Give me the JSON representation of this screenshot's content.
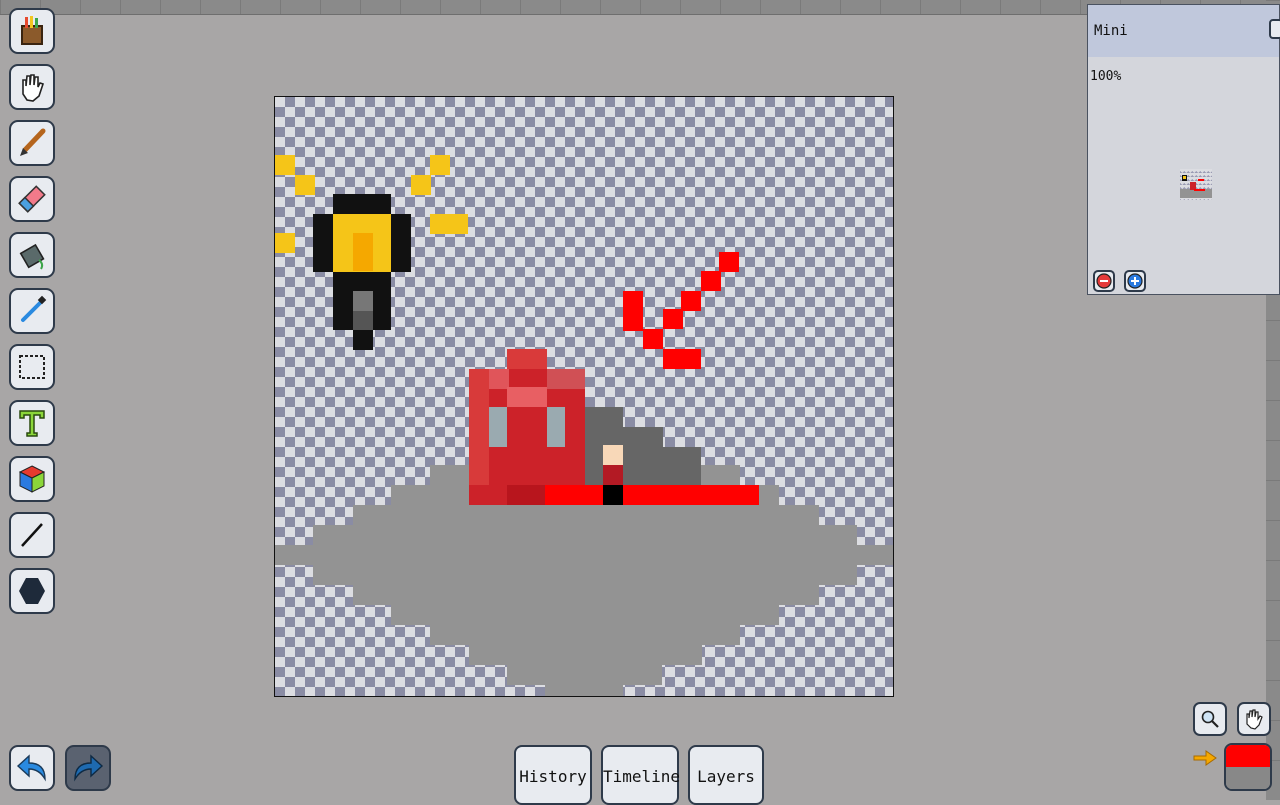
{
  "toolbar": {
    "tools": [
      {
        "name": "palette-tool",
        "icon": "paint-bucket-brushes-icon"
      },
      {
        "name": "hand-tool",
        "icon": "hand-icon"
      },
      {
        "name": "brush-tool",
        "icon": "brush-icon"
      },
      {
        "name": "eraser-tool",
        "icon": "eraser-icon"
      },
      {
        "name": "fill-tool",
        "icon": "paint-bucket-icon"
      },
      {
        "name": "eyedropper-tool",
        "icon": "eyedropper-icon"
      },
      {
        "name": "select-tool",
        "icon": "marquee-select-icon"
      },
      {
        "name": "text-tool",
        "icon": "text-icon"
      },
      {
        "name": "3d-tool",
        "icon": "cube-icon"
      },
      {
        "name": "line-tool",
        "icon": "line-icon"
      },
      {
        "name": "shape-tool",
        "icon": "hexagon-icon"
      }
    ]
  },
  "mini_panel": {
    "title": "Mini",
    "zoom": "100%"
  },
  "bottom_tabs": {
    "history": "History",
    "timeline": "Timeline",
    "layers": "Layers"
  },
  "colors": {
    "primary": "#ff0000",
    "secondary": "#888888",
    "canvas_check_dark": "#8a8ca4",
    "canvas_check_light": "#dcdde2"
  }
}
